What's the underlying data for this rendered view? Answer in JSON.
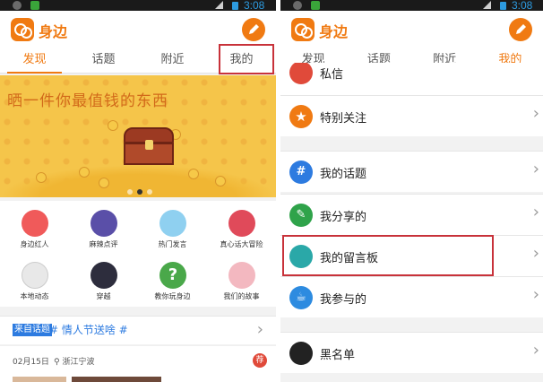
{
  "status": {
    "time": "3:08"
  },
  "app": {
    "title": "身边",
    "brand_color": "#f07a12"
  },
  "tabs": [
    "发现",
    "话题",
    "附近",
    "我的"
  ],
  "left": {
    "active_tab": "发现",
    "banner": {
      "text": "晒一件你最值钱的东西",
      "page_indicator": {
        "count": 3,
        "current": 2
      }
    },
    "grid": [
      {
        "label": "身边红人",
        "icon": "girl-avatar-icon",
        "color": "#f05a5a"
      },
      {
        "label": "麻辣点评",
        "icon": "chili-pepper-icon",
        "color": "#5a4fa8"
      },
      {
        "label": "热门发言",
        "icon": "flame-icon",
        "color": "#8fd0f0"
      },
      {
        "label": "真心话大冒险",
        "icon": "heart-icon",
        "color": "#e04a5a"
      },
      {
        "label": "本地动态",
        "icon": "map-pin-icon",
        "color": "#e8e8e8"
      },
      {
        "label": "穿越",
        "icon": "rocket-icon",
        "color": "#2d2d3d"
      },
      {
        "label": "教你玩身边",
        "icon": "question-icon",
        "color": "#4aa84a"
      },
      {
        "label": "我们的故事",
        "icon": "balloon-pin-icon",
        "color": "#f3b8c0"
      }
    ],
    "topic": {
      "tag": "来自话题",
      "text": "# 情人节送啥 #"
    },
    "post": {
      "date": "02月15日",
      "location": "浙江宁波",
      "badge": "荐"
    }
  },
  "right": {
    "active_tab": "我的",
    "items": [
      {
        "label": "私信",
        "icon": "message-icon",
        "color": "#e04a3a"
      },
      {
        "label": "特别关注",
        "icon": "star-icon",
        "color": "#f07a12"
      },
      {
        "label": "我的话题",
        "icon": "hashtag-icon",
        "color": "#2d7be0"
      },
      {
        "label": "我分享的",
        "icon": "share-icon",
        "color": "#2fa34a"
      },
      {
        "label": "我的留言板",
        "icon": "message-board-icon",
        "color": "#2aa8a8"
      },
      {
        "label": "我参与的",
        "icon": "coffee-cup-icon",
        "color": "#2d8be0"
      },
      {
        "label": "黑名单",
        "icon": "block-user-icon",
        "color": "#222222"
      }
    ]
  }
}
